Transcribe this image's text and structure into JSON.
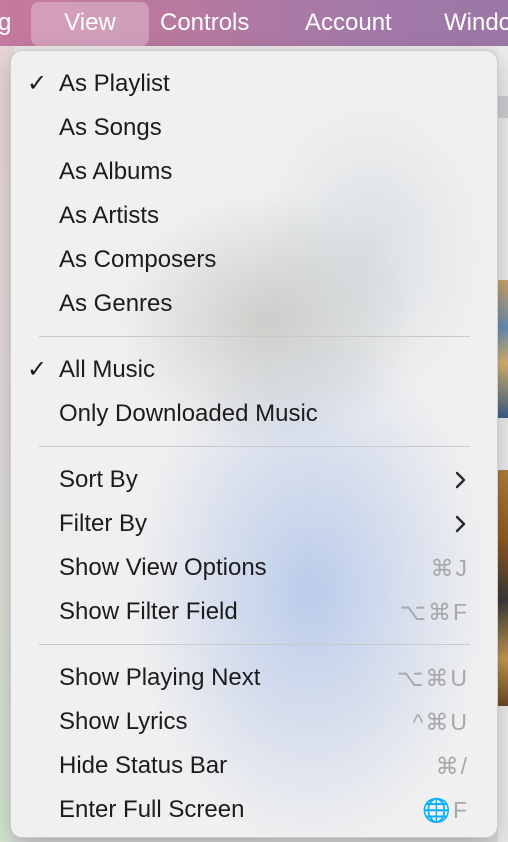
{
  "menubar": {
    "items": [
      {
        "label": "g"
      },
      {
        "label": "View"
      },
      {
        "label": "Controls"
      },
      {
        "label": "Account"
      },
      {
        "label": "Windo"
      }
    ]
  },
  "view_menu": {
    "groups": [
      [
        {
          "label": "As Playlist",
          "checked": true
        },
        {
          "label": "As Songs"
        },
        {
          "label": "As Albums"
        },
        {
          "label": "As Artists"
        },
        {
          "label": "As Composers"
        },
        {
          "label": "As Genres"
        }
      ],
      [
        {
          "label": "All Music",
          "checked": true
        },
        {
          "label": "Only Downloaded Music"
        }
      ],
      [
        {
          "label": "Sort By",
          "submenu": true
        },
        {
          "label": "Filter By",
          "submenu": true
        },
        {
          "label": "Show View Options",
          "shortcut": "⌘J"
        },
        {
          "label": "Show Filter Field",
          "shortcut": "⌥⌘F"
        }
      ],
      [
        {
          "label": "Show Playing Next",
          "shortcut": "⌥⌘U"
        },
        {
          "label": "Show Lyrics",
          "shortcut": "^⌘U"
        },
        {
          "label": "Hide Status Bar",
          "shortcut": "⌘/"
        },
        {
          "label": "Enter Full Screen",
          "shortcut": "🌐F"
        }
      ]
    ],
    "checkmark_glyph": "✓",
    "chevron_icon": "chevron-right-icon"
  },
  "colors": {
    "menubar_gradient_start": "#c7799f",
    "menubar_gradient_end": "#9a77a6",
    "menu_background": "#f1f0f0",
    "menu_text": "#1c1c1c",
    "shortcut_text": "#a8a8aa"
  }
}
